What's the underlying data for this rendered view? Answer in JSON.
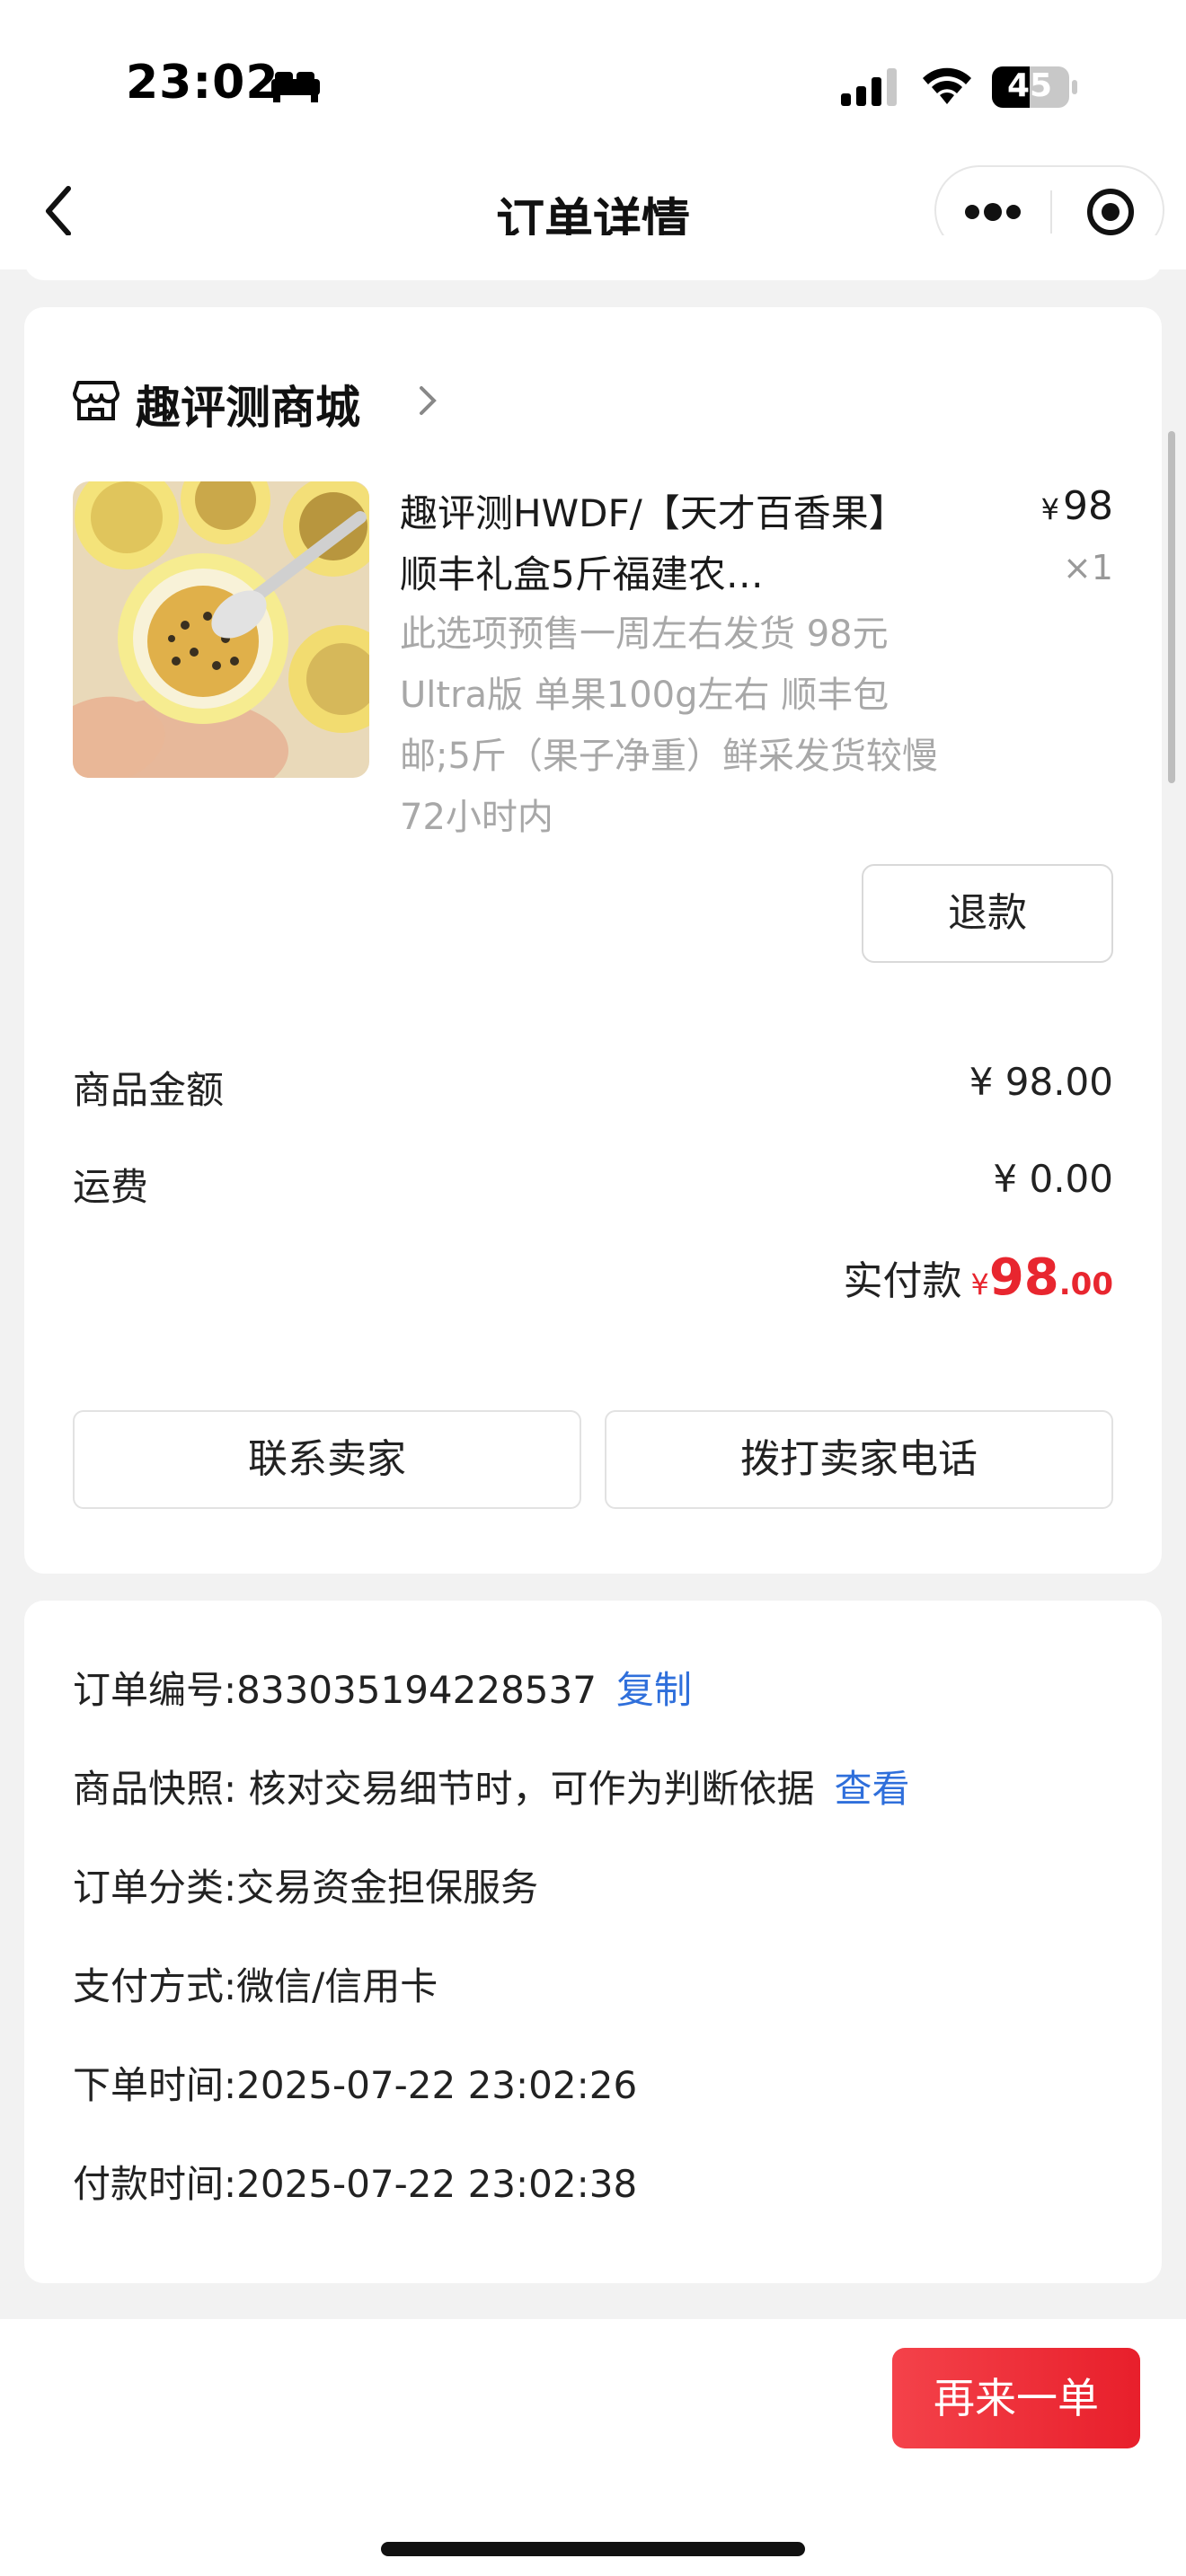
{
  "status_bar": {
    "time": "23:02",
    "battery": "45"
  },
  "nav": {
    "title": "订单详情"
  },
  "shop": {
    "name": "趣评测商城"
  },
  "product": {
    "title": "趣评测HWDF/【天才百香果】顺丰礼盒5斤福建农…",
    "price_symbol": "¥",
    "price": "98",
    "quantity": "×1",
    "spec": "此选项预售一周左右发货 98元 Ultra版 单果100g左右 顺丰包邮;5斤（果子净重）鲜采发货较慢72小时内",
    "refund_label": "退款"
  },
  "amounts": {
    "goods_label": "商品金额",
    "goods_value": "¥ 98.00",
    "shipping_label": "运费",
    "shipping_value": "¥ 0.00",
    "paid_label": "实付款",
    "paid_yen": "¥",
    "paid_int": "98",
    "paid_dec": ".00"
  },
  "actions": {
    "contact_seller": "联系卖家",
    "call_seller": "拨打卖家电话"
  },
  "info": {
    "order_no": "订单编号:833035194228537",
    "copy_label": "复制",
    "snapshot": "商品快照: 核对交易细节时，可作为判断依据",
    "view_label": "查看",
    "category": "订单分类:交易资金担保服务",
    "payment": "支付方式:微信/信用卡",
    "order_time": "下单时间:2025-07-22 23:02:26",
    "pay_time": "付款时间:2025-07-22 23:02:38"
  },
  "bottom": {
    "reorder_label": "再来一单"
  },
  "colors": {
    "price_red": "#e8262f",
    "link_blue": "#2f6fdb",
    "button_red": "#e81f2b"
  }
}
